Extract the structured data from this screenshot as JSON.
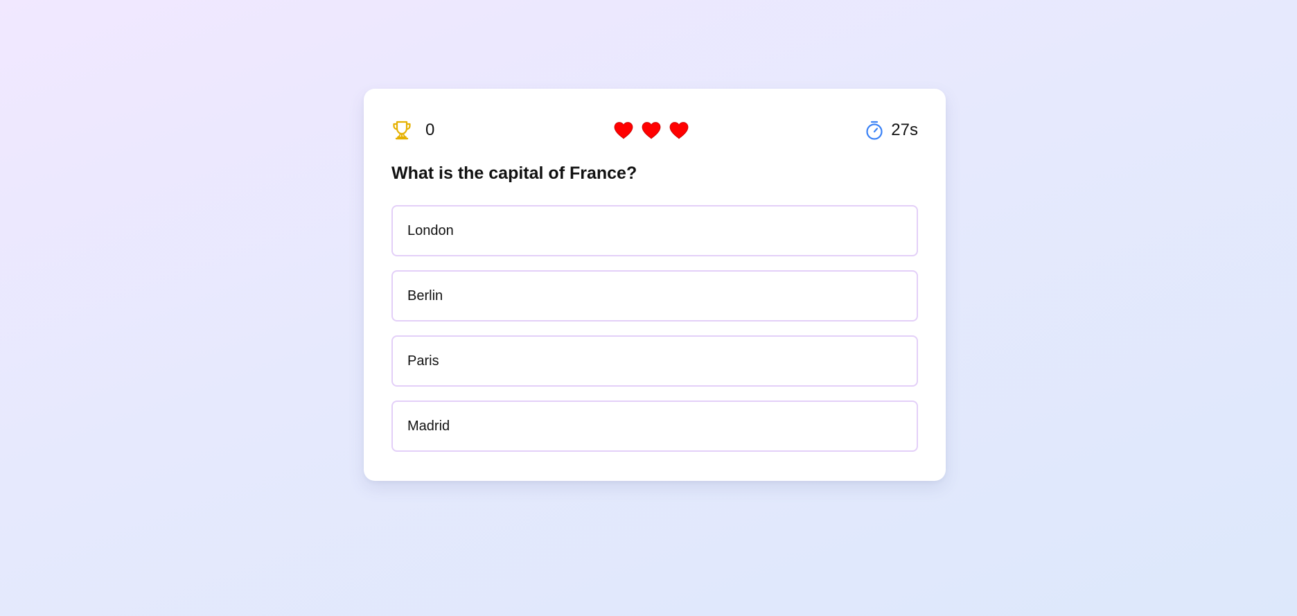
{
  "game": {
    "score": "0",
    "lives": [
      {
        "icon": "heart-icon",
        "filled": true
      },
      {
        "icon": "heart-icon",
        "filled": true
      },
      {
        "icon": "heart-icon",
        "filled": true
      }
    ],
    "timer": "27s",
    "icons": {
      "score": "trophy-icon",
      "timer": "stopwatch-icon"
    }
  },
  "question": {
    "text": "What is the capital of France?",
    "options": [
      "London",
      "Berlin",
      "Paris",
      "Madrid"
    ]
  },
  "colors": {
    "trophy": "#e5b000",
    "heart": "#ff0000",
    "stopwatch": "#3b82f6",
    "option_border": "#e3cff8"
  }
}
